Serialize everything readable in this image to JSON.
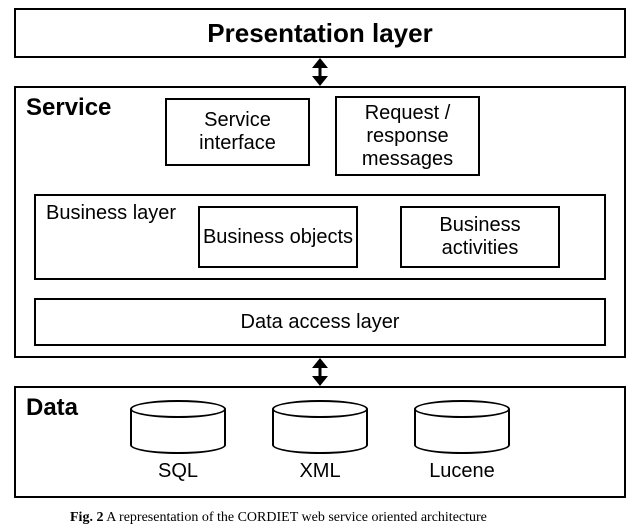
{
  "layers": {
    "presentation": {
      "title": "Presentation layer"
    },
    "service": {
      "title": "Service",
      "service_interface": "Service interface",
      "request_response": "Request / response messages",
      "business_layer": {
        "title": "Business layer",
        "business_objects": "Business objects",
        "business_activities": "Business activities"
      },
      "data_access_layer": "Data access layer"
    },
    "data": {
      "title": "Data",
      "stores": [
        "SQL",
        "XML",
        "Lucene"
      ]
    }
  },
  "caption": {
    "prefix": "Fig. 2",
    "text": "A representation of the CORDIET web service oriented architecture"
  },
  "chart_data": {
    "type": "diagram",
    "title": "CORDIET web service oriented architecture",
    "nodes": [
      {
        "id": "presentation",
        "label": "Presentation layer"
      },
      {
        "id": "service",
        "label": "Service",
        "children": [
          {
            "id": "service_interface",
            "label": "Service interface"
          },
          {
            "id": "request_response",
            "label": "Request / response messages"
          },
          {
            "id": "business_layer",
            "label": "Business layer",
            "children": [
              {
                "id": "business_objects",
                "label": "Business objects"
              },
              {
                "id": "business_activities",
                "label": "Business activities"
              }
            ]
          },
          {
            "id": "data_access_layer",
            "label": "Data access layer"
          }
        ]
      },
      {
        "id": "data",
        "label": "Data",
        "children": [
          {
            "id": "sql",
            "label": "SQL",
            "kind": "datastore"
          },
          {
            "id": "xml",
            "label": "XML",
            "kind": "datastore"
          },
          {
            "id": "lucene",
            "label": "Lucene",
            "kind": "datastore"
          }
        ]
      }
    ],
    "edges": [
      {
        "from": "presentation",
        "to": "service",
        "direction": "both"
      },
      {
        "from": "service",
        "to": "data",
        "direction": "both"
      }
    ]
  }
}
